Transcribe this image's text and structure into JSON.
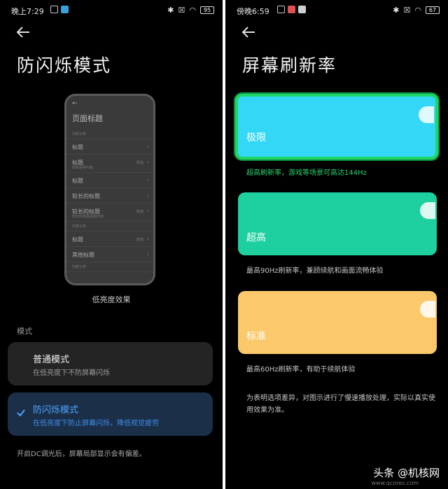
{
  "left": {
    "status": {
      "time": "晚上7:29",
      "battery": "95"
    },
    "title": "防闪烁模式",
    "preview": {
      "page_title": "页面标题",
      "rows": [
        {
          "kind": "sec",
          "title": "列表分类"
        },
        {
          "kind": "row",
          "title": "标题"
        },
        {
          "kind": "tall",
          "title": "标题",
          "sub": "标题说明内容",
          "value": "数值"
        },
        {
          "kind": "row",
          "title": "标题"
        },
        {
          "kind": "row",
          "title": "较长的标题"
        },
        {
          "kind": "tall",
          "title": "较长的标题",
          "sub": "较长的标题说明内容",
          "value": "数值"
        },
        {
          "kind": "sec",
          "title": "列表分类"
        },
        {
          "kind": "row",
          "title": "标题",
          "value": "数值"
        },
        {
          "kind": "row",
          "title": "其他标题"
        },
        {
          "kind": "sec",
          "title": "列表分类"
        }
      ]
    },
    "caption": "低亮度效果",
    "section_label": "模式",
    "options": [
      {
        "title": "普通模式",
        "subtitle": "在低亮度下不防屏幕闪烁"
      },
      {
        "title": "防闪烁模式",
        "subtitle": "在低亮度下防止屏幕闪烁，降低视觉疲劳"
      }
    ],
    "footnote": "开启DC调光后，屏幕局部显示会有偏差。"
  },
  "right": {
    "status": {
      "time": "傍晚6:59",
      "battery": "67"
    },
    "title": "屏幕刷新率",
    "cards": [
      {
        "label": "极限",
        "desc": "超高刷新率，游戏等场景可高达144Hz",
        "color": "#34d7f5"
      },
      {
        "label": "超高",
        "desc": "最高90Hz刷新率，兼顾续航和画面流畅体验",
        "color": "#1ed0a0"
      },
      {
        "label": "标准",
        "desc": "最高60Hz刷新率，有助于续航体验",
        "color": "#fbc96b"
      }
    ],
    "note": "为表明选项差异，对图示进行了慢速播放处理，实际以真实使用效果为准。",
    "watermark": "www.qcores.com"
  },
  "brand": "头条 @机核网",
  "colors": {
    "selected_border": "#1ed668",
    "selected_text": "#4fa4ff",
    "selected_bg": "#1b2f49"
  }
}
